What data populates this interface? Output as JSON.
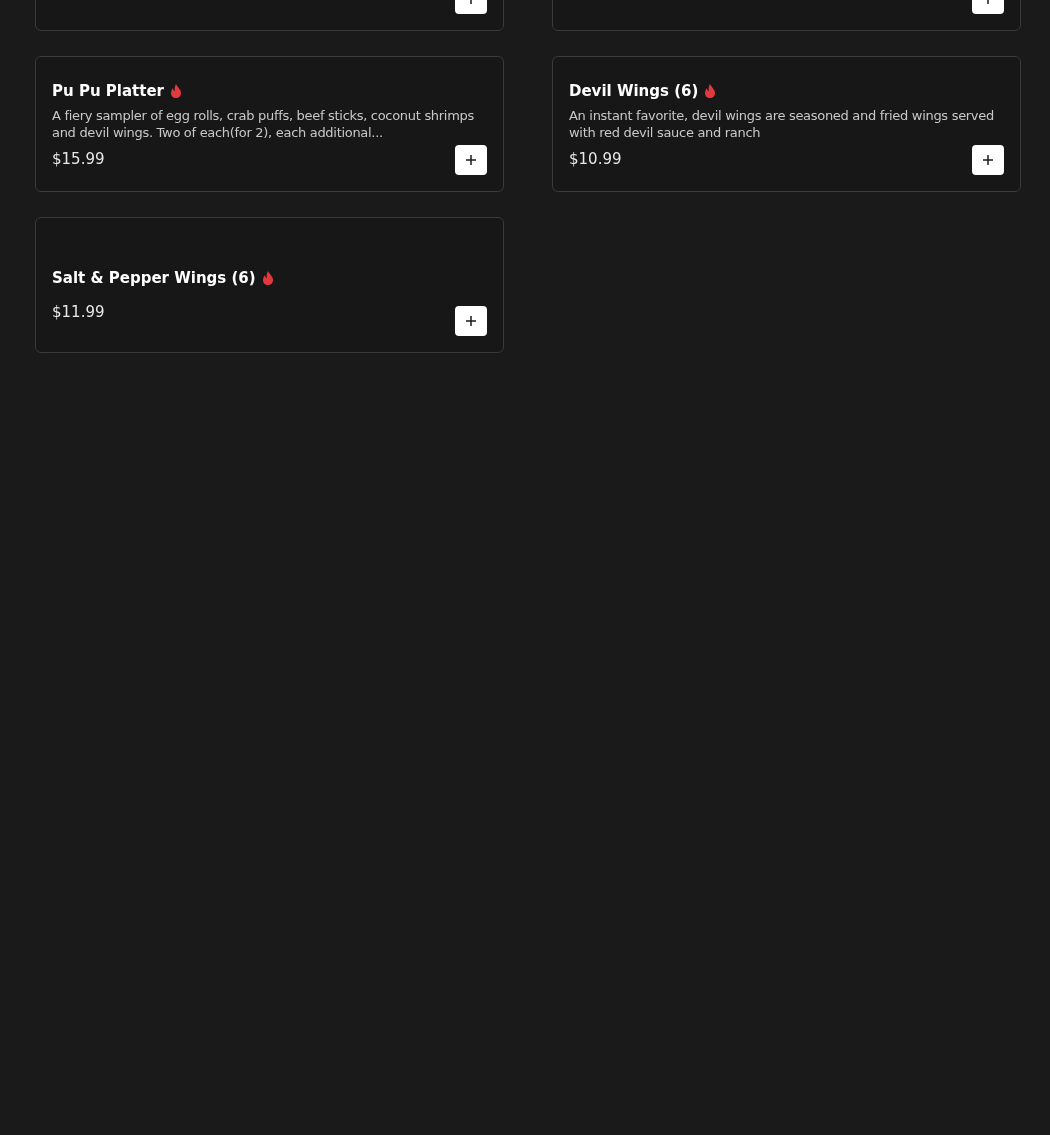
{
  "menu_items": [
    {
      "kind": "cut"
    },
    {
      "kind": "cut"
    },
    {
      "kind": "full",
      "name": "Pu Pu Platter",
      "spicy": true,
      "description": "A fiery sampler of egg rolls, crab puffs, beef sticks, coconut shrimps and devil wings. Two of each(for 2), each additional...",
      "price": "$15.99"
    },
    {
      "kind": "full",
      "name": "Devil Wings (6)",
      "spicy": true,
      "description": "An instant favorite, devil wings are seasoned and fried wings served with red devil sauce and ranch",
      "price": "$10.99"
    },
    {
      "kind": "full",
      "name": "Salt & Pepper Wings (6)",
      "spicy": true,
      "price": "$11.99"
    }
  ]
}
